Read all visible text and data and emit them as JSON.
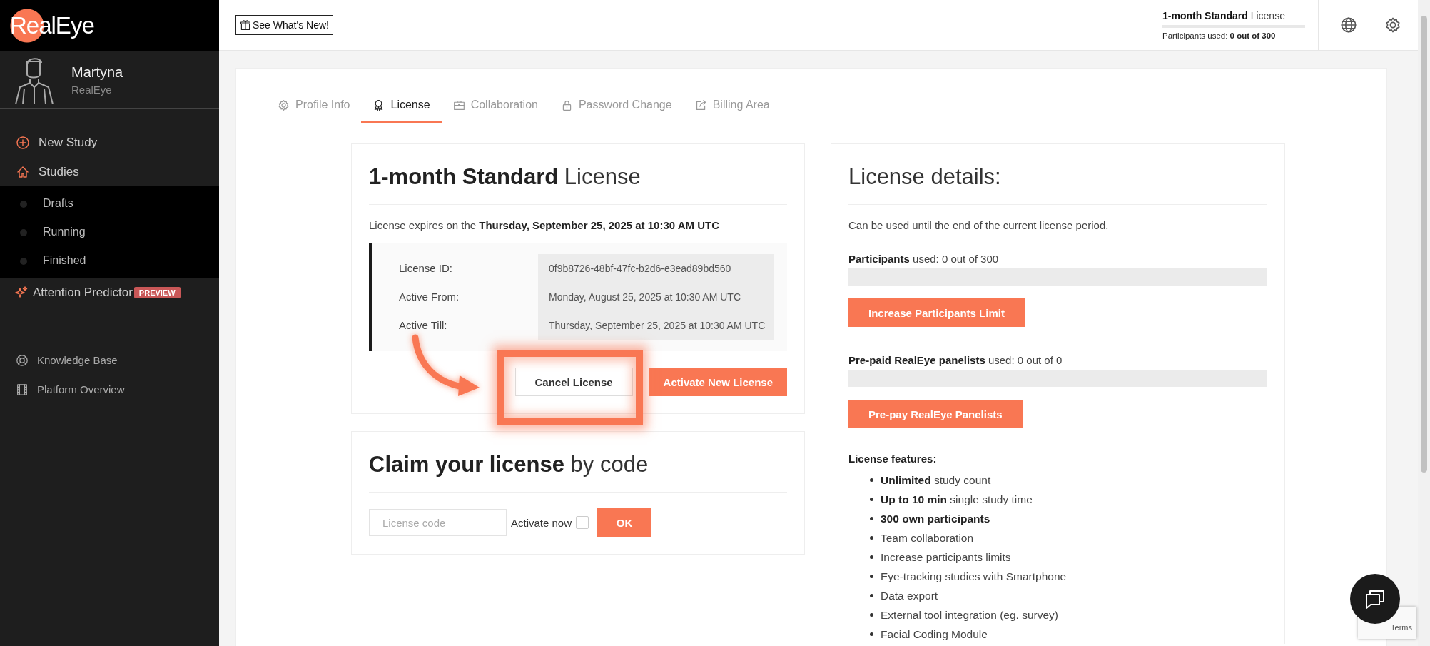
{
  "sidebar": {
    "logo": "RealEye",
    "user": {
      "name": "Martyna",
      "org": "RealEye"
    },
    "nav": [
      {
        "label": "New Study"
      },
      {
        "label": "Studies",
        "children": [
          {
            "label": "Drafts"
          },
          {
            "label": "Running"
          },
          {
            "label": "Finished"
          }
        ]
      },
      {
        "label": "Attention Predictor",
        "badge": "PREVIEW"
      }
    ],
    "footer": [
      {
        "label": "Knowledge Base"
      },
      {
        "label": "Platform Overview"
      }
    ]
  },
  "topbar": {
    "whats_new": "See What's New!",
    "license": "**1-month Standard** License",
    "participants": "Participants used: **0 out of 300**"
  },
  "tabs": [
    {
      "label": "Profile Info",
      "selected": false
    },
    {
      "label": "License",
      "selected": true
    },
    {
      "label": "Collaboration",
      "selected": false
    },
    {
      "label": "Password Change",
      "selected": false
    },
    {
      "label": "Billing Area",
      "selected": false
    }
  ],
  "license_card": {
    "title": "**1-month Standard** License",
    "expiry": "License expires on the **Thursday, September 25, 2025 at 10:30 AM UTC**",
    "details": [
      {
        "label": "License ID:",
        "value": "0f9b8726-48bf-47fc-b2d6-e3ead89bd560"
      },
      {
        "label": "Active From:",
        "value": "Monday, August 25, 2025 at 10:30 AM UTC"
      },
      {
        "label": "Active Till:",
        "value": "Thursday, September 25, 2025 at 10:30 AM UTC"
      }
    ],
    "buttons": [
      {
        "label": "Cancel License",
        "kind": "outline",
        "highlighted": true
      },
      {
        "label": "Activate New License",
        "kind": "primary",
        "highlighted": false
      }
    ]
  },
  "claim_card": {
    "title": "**Claim your license** by code",
    "code_field": {
      "placeholder": "License code"
    },
    "activate_now": {
      "label": "Activate now",
      "checked": false
    },
    "ok": "OK"
  },
  "details_card": {
    "title": "License details:",
    "note": "Can be used until the end of the current license period.",
    "usages": [
      {
        "text": "**Participants** used: 0 out of 300",
        "level": 0,
        "button": "Increase Participants Limit"
      },
      {
        "text": "**Pre-paid RealEye panelists** used: 0 out of 0",
        "level": 0,
        "button": "Pre-pay RealEye Panelists"
      }
    ],
    "features_title": "License features:",
    "features": [
      "**Unlimited** study count",
      "**Up to 10 min** single study time",
      "**300 own participants**",
      "Team collaboration",
      "Increase participants limits",
      "Eye-tracking studies with Smartphone",
      "Data export",
      "External tool integration (eg. survey)",
      "Facial Coding Module"
    ]
  },
  "recaptcha": {
    "terms": "Terms"
  }
}
